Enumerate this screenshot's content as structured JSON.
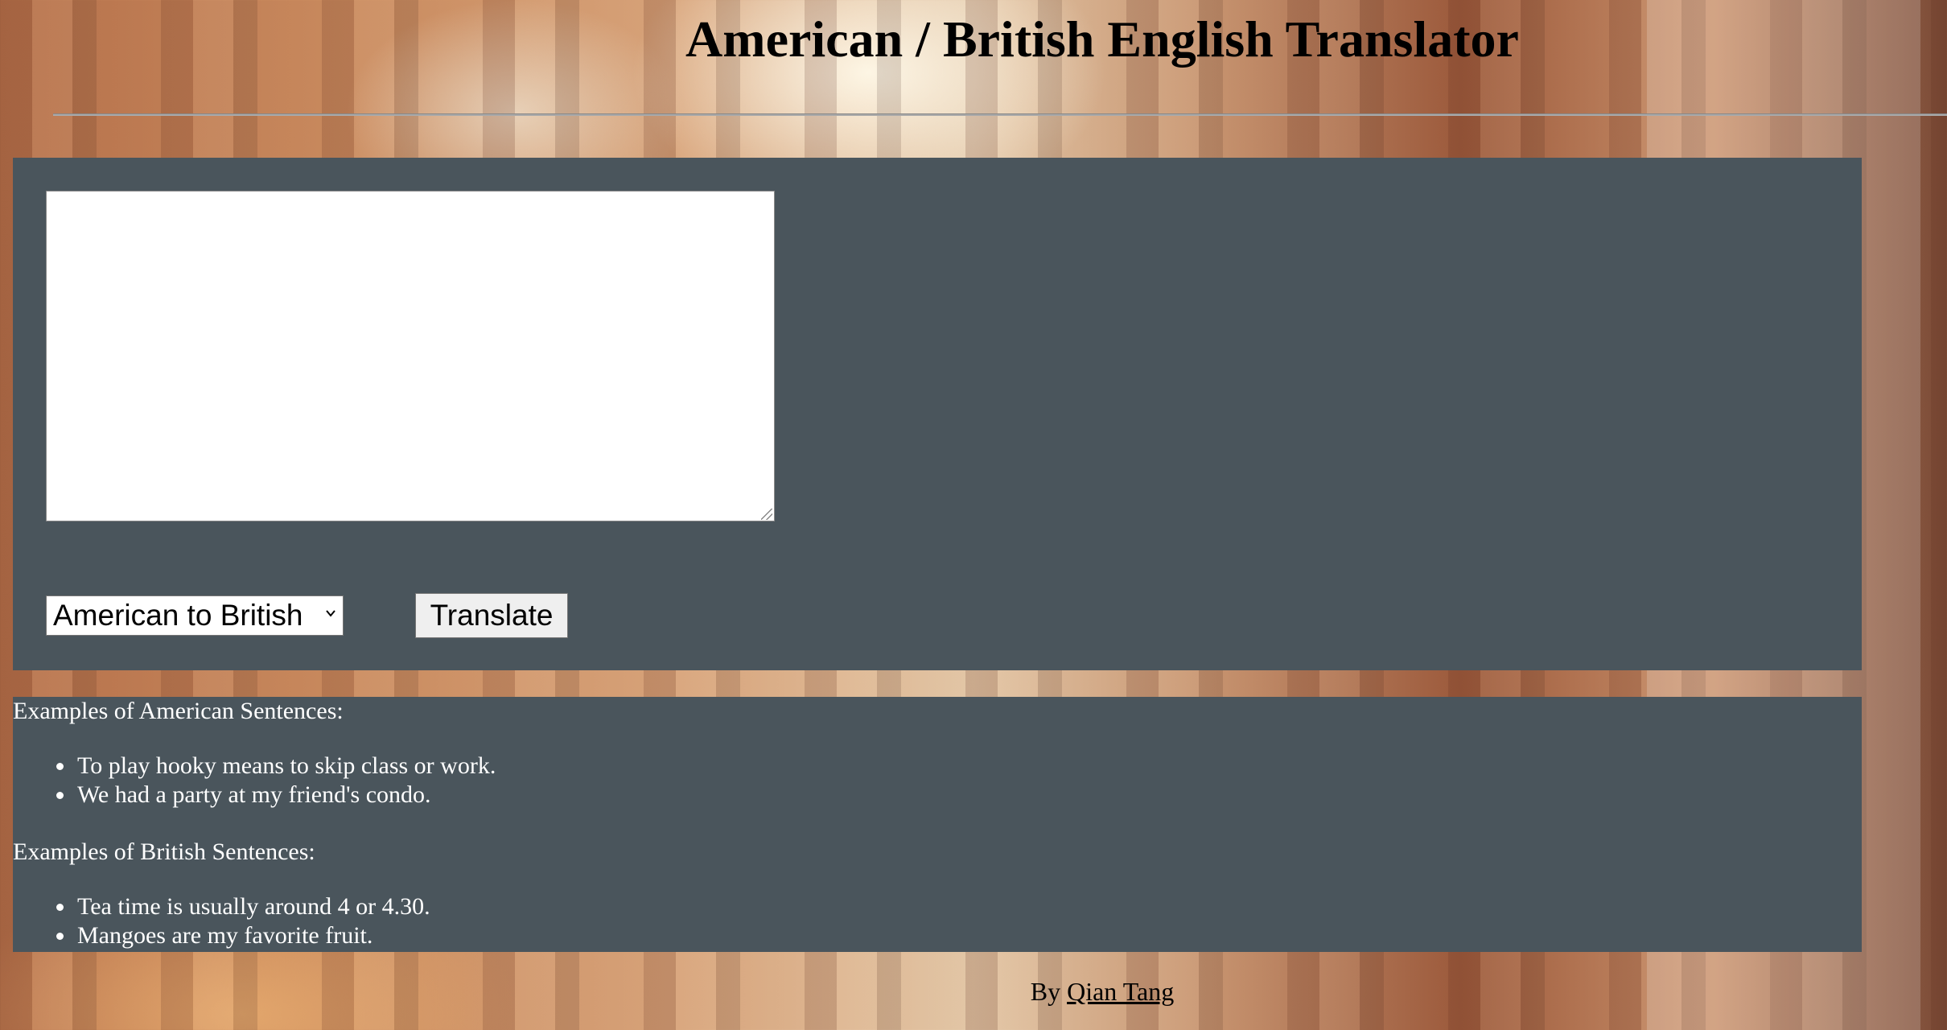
{
  "header": {
    "title": "American / British English Translator"
  },
  "translator": {
    "input_value": "",
    "direction_selected": "American to British",
    "translate_label": "Translate"
  },
  "examples": {
    "american_heading": "Examples of American Sentences:",
    "american": [
      "To play hooky means to skip class or work.",
      "We had a party at my friend's condo."
    ],
    "british_heading": "Examples of British Sentences:",
    "british": [
      "Tea time is usually around 4 or 4.30.",
      "Mangoes are my favorite fruit."
    ]
  },
  "footer": {
    "by_label": "By",
    "author": "Qian Tang"
  },
  "colors": {
    "panel": "#4a555c",
    "panel_text": "#ffffff"
  }
}
